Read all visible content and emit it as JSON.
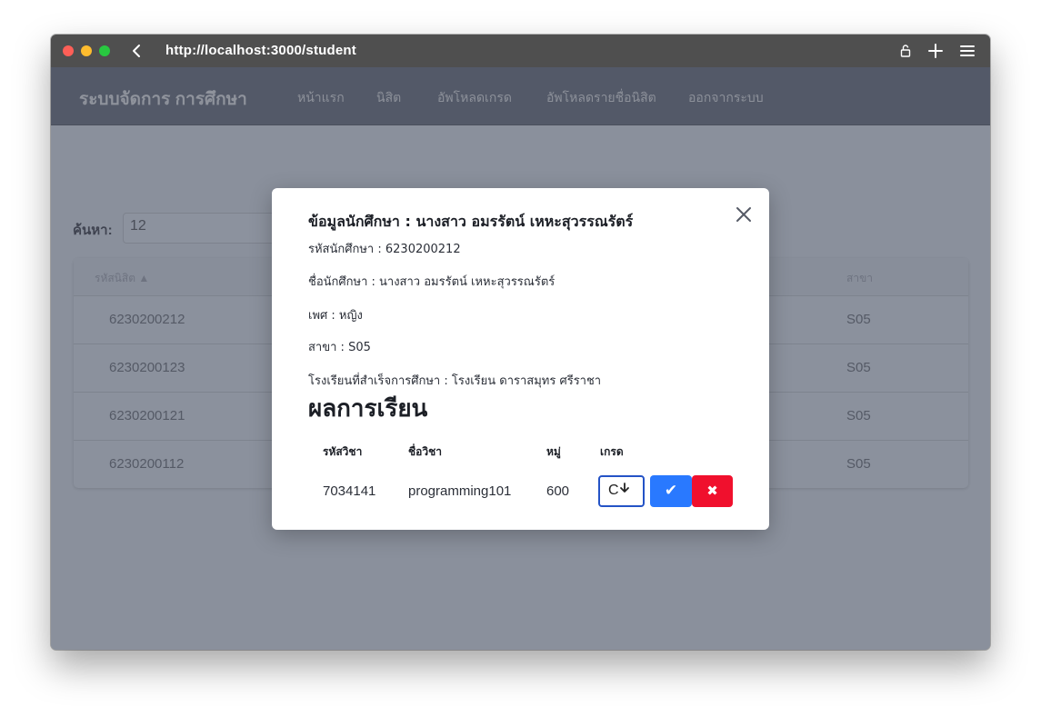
{
  "browser": {
    "url": "http://localhost:3000/student",
    "back_glyph": "‹"
  },
  "navbar": {
    "brand": "ระบบจัดการ การศึกษา",
    "links": [
      "หน้าแรก",
      "นิสิต",
      "อัพโหลดเกรด",
      "อัพโหลดรายชื่อนิสิต",
      "ออกจากระบบ"
    ]
  },
  "search": {
    "label": "ค้นหา:",
    "value": "12"
  },
  "table": {
    "headers": {
      "id": "รหัสนิสิต ▲",
      "major": "สาขา"
    },
    "rows": [
      {
        "id": "6230200212",
        "major": "S05"
      },
      {
        "id": "6230200123",
        "major": "S05"
      },
      {
        "id": "6230200121",
        "major": "S05"
      },
      {
        "id": "6230200112",
        "major": "S05"
      }
    ]
  },
  "modal": {
    "title": "ข้อมูลนักศึกษา : นางสาว อมรรัตน์ เหหะสุวรรณรัตร์",
    "student_id_line": "รหัสนักศึกษา : 6230200212",
    "name_line": "ชื่อนักศึกษา : นางสาว อมรรัตน์ เหหะสุวรรณรัตร์",
    "gender_line": "เพศ : หญิง",
    "major_line": "สาขา : S05",
    "school_line": "โรงเรียนที่สำเร็จการศึกษา : โรงเรียน ดาราสมุทร ศรีราชา",
    "results_title": "ผลการเรียน",
    "grades_table": {
      "headers": [
        "รหัสวิชา",
        "ชื่อวิชา",
        "หมู่",
        "เกรด"
      ],
      "row": {
        "course_code": "7034141",
        "course_name": "programming101",
        "section": "600",
        "grade": "C"
      }
    },
    "confirm_glyph": "✔",
    "cancel_glyph": "✖"
  },
  "colors": {
    "overlay": "#8a909c",
    "navbar": "#535968",
    "confirm": "#2979ff",
    "cancel": "#f0102d",
    "select_border": "#2453c6"
  }
}
